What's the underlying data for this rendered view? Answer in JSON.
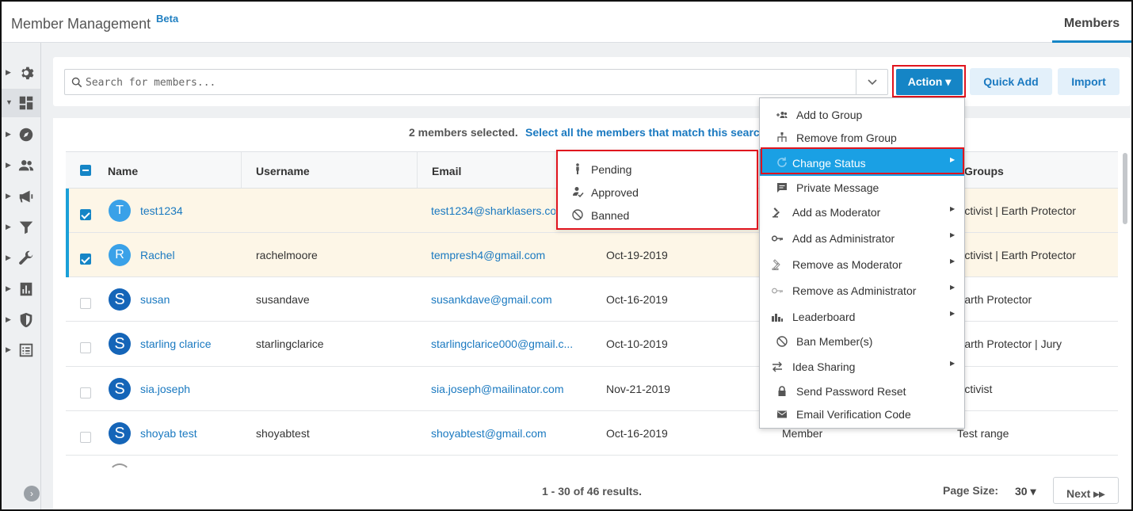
{
  "header": {
    "app_title": "Member Management",
    "beta_badge": "Beta",
    "members_tab": "Members"
  },
  "sidebar": {
    "items": [
      {
        "icon": "gear-icon"
      },
      {
        "icon": "dashboard-icon",
        "active": true
      },
      {
        "icon": "compass-icon"
      },
      {
        "icon": "people-icon"
      },
      {
        "icon": "megaphone-icon"
      },
      {
        "icon": "filter-icon"
      },
      {
        "icon": "wrench-icon"
      },
      {
        "icon": "bar-chart-icon"
      },
      {
        "icon": "shield-icon"
      },
      {
        "icon": "list-icon"
      }
    ]
  },
  "search": {
    "placeholder": "Search for members..."
  },
  "toolbar": {
    "action_label": "Action ▾",
    "quick_add_label": "Quick Add",
    "import_label": "Import"
  },
  "selection": {
    "info": "2 members selected.",
    "select_all": "Select all the members that match this search"
  },
  "table": {
    "columns": [
      "Name",
      "Username",
      "Email",
      "Groups"
    ],
    "rows": [
      {
        "avatar": "T",
        "avatar_style": "light",
        "name": "test1234",
        "username": "",
        "email": "test1234@sharklasers.com",
        "date": "",
        "role": "",
        "groups": "Activist | Earth Protector",
        "selected": true
      },
      {
        "avatar": "R",
        "avatar_style": "light",
        "name": "Rachel",
        "username": "rachelmoore",
        "email": "tempresh4@gmail.com",
        "date": "Oct-19-2019",
        "role": "",
        "groups": "Activist | Earth Protector",
        "selected": true
      },
      {
        "avatar": "S",
        "avatar_style": "dark",
        "name": "susan",
        "username": "susandave",
        "email": "susankdave@gmail.com",
        "date": "Oct-16-2019",
        "role": "",
        "groups": "Earth Protector",
        "selected": false
      },
      {
        "avatar": "S",
        "avatar_style": "dark",
        "name": "starling clarice",
        "username": "starlingclarice",
        "email": "starlingclarice000@gmail.c...",
        "date": "Oct-10-2019",
        "role": "",
        "groups": "Earth Protector | Jury",
        "selected": false
      },
      {
        "avatar": "S",
        "avatar_style": "dark",
        "name": "sia.joseph",
        "username": "",
        "email": "sia.joseph@mailinator.com",
        "date": "Nov-21-2019",
        "role": "",
        "groups": "Activist",
        "selected": false
      },
      {
        "avatar": "S",
        "avatar_style": "dark",
        "name": "shoyab test",
        "username": "shoyabtest",
        "email": "shoyabtest@gmail.com",
        "date": "Oct-16-2019",
        "role": "Member",
        "groups": "Test range",
        "selected": false
      }
    ]
  },
  "footer": {
    "results": "1 - 30 of 46 results.",
    "page_size_label": "Page Size:",
    "page_size_value": "30 ▾",
    "next_label": "Next ▸▸"
  },
  "action_menu": {
    "items": [
      {
        "label": "Add to Group",
        "icon": "add-group-icon",
        "submenu": false
      },
      {
        "label": "Remove from Group",
        "icon": "hierarchy-icon",
        "submenu": false
      },
      {
        "label": "Change Status",
        "icon": "refresh-icon",
        "submenu": true,
        "highlighted": true
      },
      {
        "label": "Private Message",
        "icon": "message-icon",
        "submenu": false
      },
      {
        "label": "Add as Moderator",
        "icon": "gavel-icon",
        "submenu": true
      },
      {
        "label": "Add as Administrator",
        "icon": "key-icon",
        "submenu": true
      },
      {
        "label": "Remove as Moderator",
        "icon": "gavel-outline-icon",
        "submenu": true
      },
      {
        "label": "Remove as Administrator",
        "icon": "key-outline-icon",
        "submenu": true
      },
      {
        "label": "Leaderboard",
        "icon": "leaderboard-icon",
        "submenu": true
      },
      {
        "label": "Ban Member(s)",
        "icon": "ban-icon",
        "submenu": false
      },
      {
        "label": "Idea Sharing",
        "icon": "swap-icon",
        "submenu": true
      },
      {
        "label": "Send Password Reset",
        "icon": "lock-icon",
        "submenu": false
      },
      {
        "label": "Email Verification Code",
        "icon": "envelope-icon",
        "submenu": false
      }
    ]
  },
  "status_menu": {
    "items": [
      {
        "label": "Pending",
        "icon": "person-icon"
      },
      {
        "label": "Approved",
        "icon": "person-check-icon"
      },
      {
        "label": "Banned",
        "icon": "ban-icon"
      }
    ]
  },
  "colors": {
    "accent": "#1585c6",
    "link": "#1a79c0",
    "highlight_box": "#e0141e",
    "selected_row": "#fdf6e7",
    "menu_highlight": "#1aa0e4"
  }
}
